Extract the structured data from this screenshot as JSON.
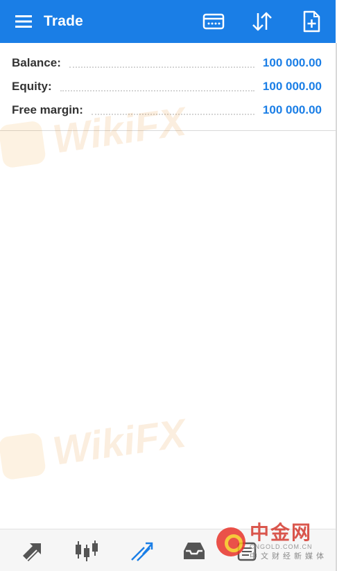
{
  "header": {
    "title": "Trade",
    "icons": [
      "menu-icon",
      "calculator-icon",
      "sort-icon",
      "add-order-icon"
    ]
  },
  "account": {
    "rows": [
      {
        "label": "Balance:",
        "value": "100 000.00"
      },
      {
        "label": "Equity:",
        "value": "100 000.00"
      },
      {
        "label": "Free margin:",
        "value": "100 000.00"
      }
    ]
  },
  "watermarks": {
    "wikifx": "WikiFX",
    "cngold_cn": "中金网",
    "cngold_domain": "CNGOLD.COM.CN",
    "cngold_sub": "中文财经新媒体"
  },
  "bottom_nav": [
    "quotes-icon",
    "chart-icon",
    "trade-icon",
    "history-icon",
    "messages-icon"
  ],
  "colors": {
    "accent": "#1a7ee6",
    "label": "#333333"
  }
}
